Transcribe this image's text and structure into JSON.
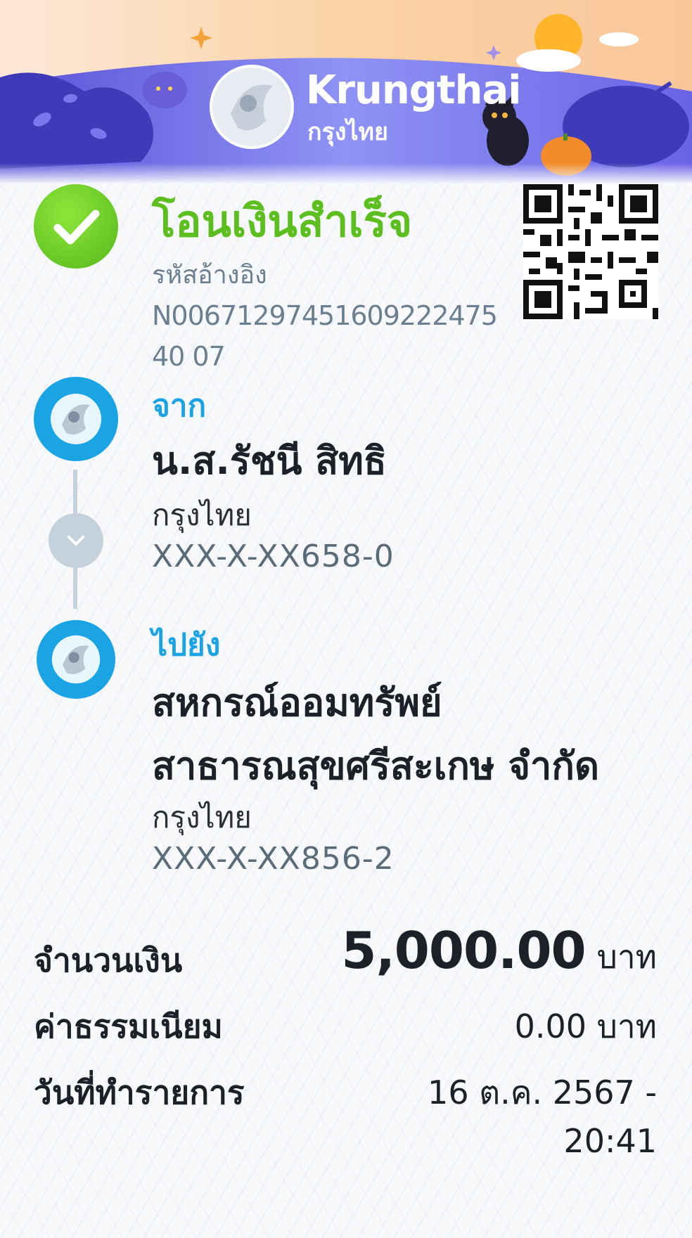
{
  "brand": {
    "name": "Krungthai",
    "name_thai": "กรุงไทย"
  },
  "status": {
    "title": "โอนเงินสำเร็จ",
    "ref_label": "รหัสอ้างอิง",
    "ref_value": "N0067129745160922247540 07"
  },
  "from": {
    "label": "จาก",
    "name": "น.ส.รัชนี สิทธิ",
    "bank": "กรุงไทย",
    "account": "XXX-X-XX658-0"
  },
  "to": {
    "label": "ไปยัง",
    "name_line1": "สหกรณ์ออมทรัพย์",
    "name_line2": "สาธารณสุขศรีสะเกษ จำกัด",
    "bank": "กรุงไทย",
    "account": "XXX-X-XX856-2"
  },
  "summary": {
    "amount_label": "จำนวนเงิน",
    "amount_value": "5,000.00",
    "amount_unit": "บาท",
    "fee_label": "ค่าธรรมเนียม",
    "fee_value": "0.00 บาท",
    "date_label": "วันที่ทำรายการ",
    "date_line1": "16 ต.ค. 2567 -",
    "date_line2": "20:41"
  },
  "icons": {
    "status": "check-icon",
    "bank": "krungthai-logo-icon",
    "connector": "chevron-down-icon",
    "qr": "qr-code-icon"
  },
  "colors": {
    "success": "#5cbf1f",
    "accent": "#1ba4e4",
    "header": "#6a63e6"
  }
}
